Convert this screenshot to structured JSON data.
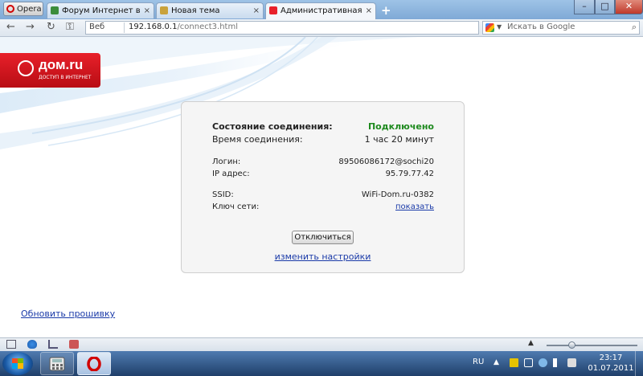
{
  "browser": {
    "menu_label": "Opera",
    "tabs": [
      {
        "label": "Форум Интернет в Ни...",
        "close": "×"
      },
      {
        "label": "Новая тема",
        "close": "×"
      },
      {
        "label": "Административная па...",
        "close": "×"
      }
    ],
    "new_tab": "+",
    "window_controls": {
      "min": "–",
      "max": "□",
      "close": "✕"
    }
  },
  "addressbar": {
    "back": "←",
    "forward": "→",
    "reload": "↻",
    "key": "⚿",
    "web_label": "Веб",
    "url_host": "192.168.0.1",
    "url_path": "/connect3.html",
    "search_placeholder": "Искать в Google",
    "search_icon": "⌕"
  },
  "page": {
    "logo": {
      "brand": "дом.ru",
      "tagline": "ДОСТУП В ИНТЕРНЕТ"
    },
    "status": {
      "state_label": "Состояние соединения:",
      "state_value": "Подключено",
      "time_label": "Время соединения:",
      "time_value": "1 час 20 минут",
      "login_label": "Логин:",
      "login_value": "89506086172@sochi20",
      "ip_label": "IP адрес:",
      "ip_value": "95.79.77.42",
      "ssid_label": "SSID:",
      "ssid_value": "WiFi-Dom.ru-0382",
      "key_label": "Ключ сети:",
      "key_link": "показать"
    },
    "disconnect_button": "Отключиться",
    "change_settings_link": "изменить настройки",
    "update_firmware_link": "Обновить прошивку"
  },
  "statusbar": {
    "zoom_up": "▲",
    "zoom_percent": 0.25
  },
  "taskbar": {
    "language": "RU",
    "time": "23:17",
    "date": "01.07.2011"
  },
  "colors": {
    "connected": "#1e8a1e",
    "link": "#1a3aa8",
    "brand_red": "#e8202a"
  }
}
